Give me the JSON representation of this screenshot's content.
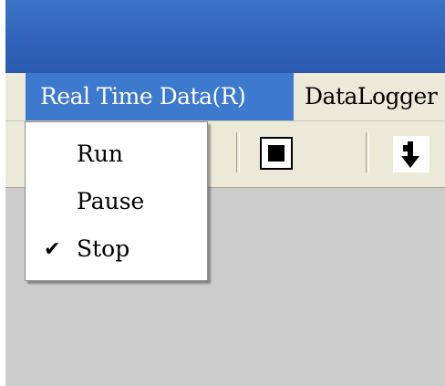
{
  "menubar": {
    "items": [
      {
        "label": "Real Time Data(R)",
        "active": true
      },
      {
        "label": "DataLogger"
      }
    ]
  },
  "toolbar": {
    "buttons": [
      {
        "icon": "stop-square-icon"
      },
      {
        "icon": "download-arrow-icon"
      }
    ]
  },
  "dropdown": {
    "items": [
      {
        "label": "Run",
        "checked": false
      },
      {
        "label": "Pause",
        "checked": false
      },
      {
        "label": "Stop",
        "checked": true,
        "check_glyph": "✔"
      }
    ]
  },
  "colors": {
    "titlebar": "#2f62b8",
    "menu_highlight": "#3d79cc",
    "menubar_bg": "#ece9d8",
    "content_bg": "#cccccc"
  }
}
